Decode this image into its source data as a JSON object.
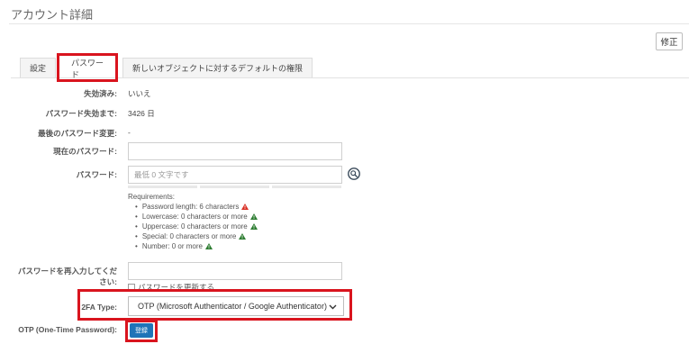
{
  "page_title": "アカウント詳細",
  "edit_button": "修正",
  "tabs": [
    {
      "label": "設定"
    },
    {
      "label": "パスワード"
    },
    {
      "label": "新しいオブジェクトに対するデフォルトの権限"
    }
  ],
  "fields": {
    "expired_label": "失効済み:",
    "expired_value": "いいえ",
    "until_expiry_label": "パスワード失効まで:",
    "until_expiry_value": "3426 日",
    "last_change_label": "最後のパスワード変更:",
    "last_change_value": "-",
    "current_password_label": "現在のパスワード:",
    "password_label": "パスワード:",
    "password_placeholder": "最低 0 文字です",
    "reenter_label": "パスワードを再入力してください:",
    "update_password_label": "パスワードを更新する",
    "twofa_label": "2FA Type:",
    "twofa_selected": "OTP (Microsoft Authenticator / Google Authenticator)",
    "otp_label": "OTP (One-Time Password):",
    "otp_button": "登録"
  },
  "requirements": {
    "title": "Requirements:",
    "items": [
      {
        "text": "Password length: 6 characters",
        "status": "fail"
      },
      {
        "text": "Lowercase: 0 characters or more",
        "status": "ok"
      },
      {
        "text": "Uppercase: 0 characters or more",
        "status": "ok"
      },
      {
        "text": "Special: 0 characters or more",
        "status": "ok"
      },
      {
        "text": "Number: 0 or more",
        "status": "ok"
      }
    ]
  },
  "colors": {
    "highlight": "#d9141e",
    "primary_button": "#1f74b8",
    "fail": "#d93025",
    "ok": "#2e7d32"
  }
}
